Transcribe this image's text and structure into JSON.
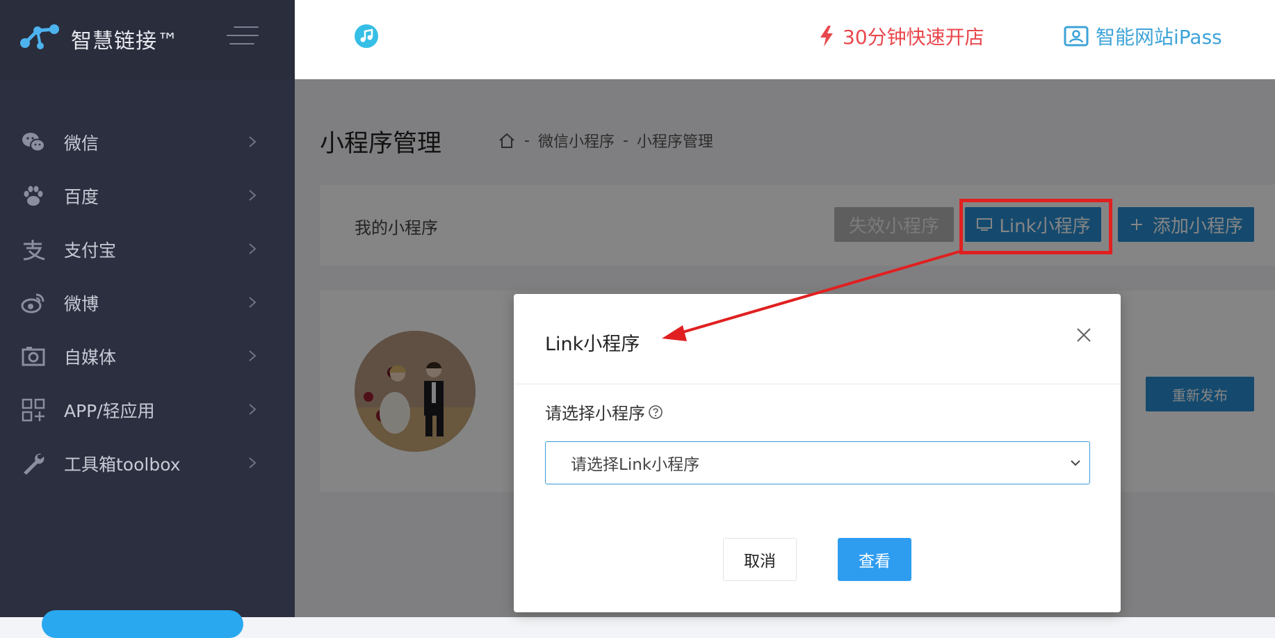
{
  "brand": {
    "name": "智慧链接™"
  },
  "sidebar": {
    "items": [
      {
        "label": "微信",
        "icon": "wechat-icon"
      },
      {
        "label": "百度",
        "icon": "paw-icon"
      },
      {
        "label": "支付宝",
        "icon": "alipay-icon"
      },
      {
        "label": "微博",
        "icon": "weibo-icon"
      },
      {
        "label": "自媒体",
        "icon": "camera-icon"
      },
      {
        "label": "APP/轻应用",
        "icon": "app-grid-icon"
      },
      {
        "label": "工具箱toolbox",
        "icon": "wrench-icon"
      }
    ]
  },
  "header": {
    "promo_fast_store": "30分钟快速开店",
    "promo_ipass": "智能网站iPass"
  },
  "main": {
    "page_title": "小程序管理",
    "breadcrumb": {
      "sep": "-",
      "level1": "微信小程序",
      "level2": "小程序管理"
    },
    "toolbar": {
      "label": "我的小程序",
      "inactive_button": "失效小程序",
      "link_button": "Link小程序",
      "add_button": "添加小程序"
    },
    "card": {
      "republish_button": "重新发布"
    }
  },
  "modal": {
    "title": "Link小程序",
    "field_label": "请选择小程序",
    "select_placeholder": "请选择Link小程序",
    "cancel_button": "取消",
    "view_button": "查看"
  },
  "colors": {
    "sidebar_bg": "#2c2f3f",
    "accent_blue": "#2a8fd4",
    "promo_red": "#e8484d",
    "promo_blue": "#3ca3d8",
    "annotation_red": "#e02020"
  }
}
